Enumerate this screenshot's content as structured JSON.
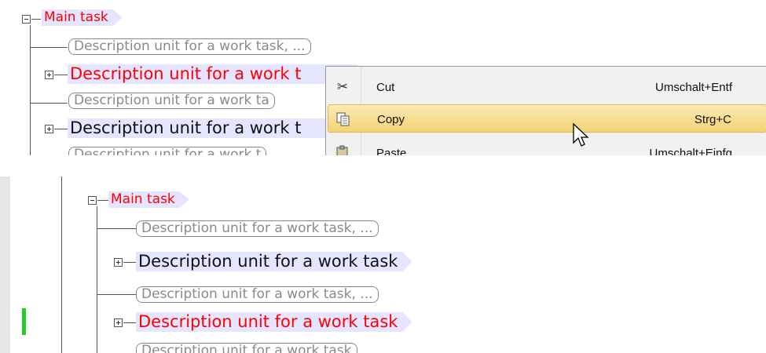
{
  "top": {
    "main_task": "Main task",
    "rows": [
      "Description unit for a work task, ...",
      "Description unit for a work t",
      "Description unit for a work ta",
      "Description unit for a work t",
      "Description unit for a work t"
    ],
    "context_menu": {
      "items": [
        {
          "label": "Cut",
          "shortcut": "Umschalt+Entf",
          "icon": "scissors-icon",
          "highlighted": false
        },
        {
          "label": "Copy",
          "shortcut": "Strg+C",
          "icon": "copy-icon",
          "highlighted": true
        },
        {
          "label": "Paste",
          "shortcut": "Umschalt+Einfg",
          "icon": "paste-icon",
          "highlighted": false
        }
      ]
    }
  },
  "bottom": {
    "main_task": "Main task",
    "rows": [
      "Description unit for a work task, ...",
      "Description unit for a work task",
      "Description unit for a work task, ...",
      "Description unit for a work task",
      "Description unit for a work task"
    ]
  },
  "colors": {
    "node_fill": "#e6e5ff",
    "red_text": "#ff0000",
    "highlight": "#f5d374",
    "green_marker": "#22cc22"
  }
}
